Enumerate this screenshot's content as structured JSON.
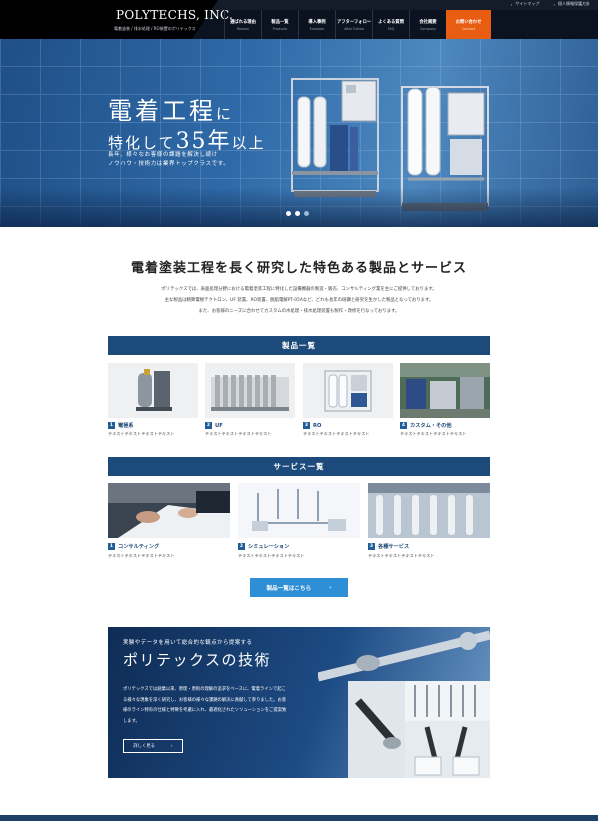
{
  "topbar": {
    "links": [
      {
        "label": "サイトマップ"
      },
      {
        "label": "個人情報保護方針"
      }
    ]
  },
  "header": {
    "logo_text": "POLYTECHS, INC.",
    "logo_sub": "電着塗装 / 排水処理 / RO装置のポリテックス",
    "nav": [
      {
        "jp": "選ばれる理由",
        "en": "Reason"
      },
      {
        "jp": "製品一覧",
        "en": "Products"
      },
      {
        "jp": "導入事例",
        "en": "Example"
      },
      {
        "jp": "アフターフォロー",
        "en": "After Follow"
      },
      {
        "jp": "よくある質問",
        "en": "FAQ"
      },
      {
        "jp": "会社概要",
        "en": "Company"
      }
    ],
    "contact": {
      "jp": "お問い合わせ",
      "en": "Contact"
    }
  },
  "hero": {
    "title_main": "電着工程",
    "title_particle": "に",
    "title_line2_pre": "特化して",
    "title_line2_num": "35年",
    "title_line2_post": "以上",
    "desc_line1": "長年、様々なお客様の課題を解決し続け",
    "desc_line2": "ノウハウ・技術力は業界トップクラスです。",
    "slide_count": 3,
    "active_slide": 2
  },
  "intro": {
    "title": "電着塗装工程を長く研究した特色ある製品とサービス",
    "lines": [
      "ポリテックスでは、表面処理分野における電着塗装工程に特化した設備機器の製造・販売、コンサルティング業を主にご提供しております。",
      "主な製品は精算電極テクトロン、UF 装置、RO装置、脱脂電解PT-05Aなど、どれも長年の研鑽と研究を生かした製品となっております。",
      "また、お客様のニーズに合わせてカスタムの水処理・排水処理装置も製作・改修を行なっております。"
    ]
  },
  "products": {
    "heading": "製品一覧",
    "items": [
      {
        "num": "1",
        "label": "電極系",
        "text": "テキストテキストテキストテキスト"
      },
      {
        "num": "2",
        "label": "UF",
        "text": "テキストテキストテキストテキスト"
      },
      {
        "num": "3",
        "label": "RO",
        "text": "テキストテキストテキストテキスト"
      },
      {
        "num": "4",
        "label": "カスタム・その他",
        "text": "テキストテキストテキストテキスト"
      }
    ]
  },
  "services": {
    "heading": "サービス一覧",
    "items": [
      {
        "num": "1",
        "label": "コンサルティング",
        "text": "テキストテキストテキストテキスト"
      },
      {
        "num": "2",
        "label": "シミュレーション",
        "text": "テキストテキストテキストテキスト"
      },
      {
        "num": "3",
        "label": "各種サービス",
        "text": "テキストテキストテキストテキスト"
      }
    ]
  },
  "cta": {
    "label": "製品一覧はこちら",
    "arrow": "›"
  },
  "tech": {
    "kicker": "実験やデータを用いて総合的な観点から提案する",
    "title": "ポリテックスの技術",
    "body": "ポリテックスでは創業以来、原理・原則の理解の追求をベースに、電着ラインで起こる様々な現象を深く研究し、お客様の様々な課題の解決に貢献して参りました。お客様のライン特有の仕様と特徴を考慮に入れ、最適化されたソリューションをご提案致します。",
    "button": "詳しく見る",
    "button_arrow": "›"
  },
  "colors": {
    "accent_orange": "#e85d12",
    "navy": "#1c4a7a",
    "cta_blue": "#2f8fd6"
  }
}
